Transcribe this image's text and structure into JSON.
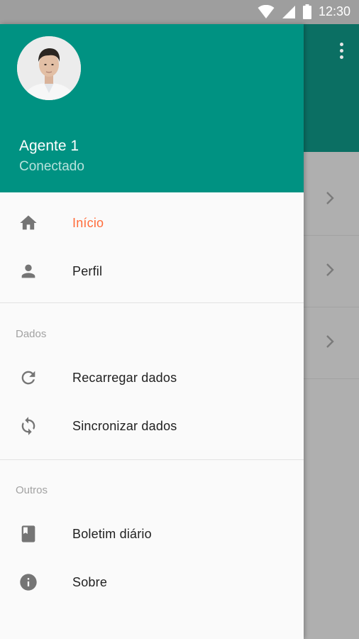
{
  "status_bar": {
    "time": "12:30",
    "icons": [
      "wifi-icon",
      "signal-icon",
      "battery-icon"
    ]
  },
  "colors": {
    "header": "#009282",
    "active": "#ff6c3a",
    "background_toolbar": "#0b6f63"
  },
  "drawer": {
    "header": {
      "name": "Agente 1",
      "status": "Conectado"
    },
    "items_main": [
      {
        "label": "Início",
        "icon": "home-icon",
        "active": true
      },
      {
        "label": "Perfil",
        "icon": "person-icon",
        "active": false
      }
    ],
    "section_dados": {
      "title": "Dados",
      "items": [
        {
          "label": "Recarregar dados",
          "icon": "refresh-icon"
        },
        {
          "label": "Sincronizar dados",
          "icon": "sync-icon"
        }
      ]
    },
    "section_outros": {
      "title": "Outros",
      "items": [
        {
          "label": "Boletim diário",
          "icon": "book-icon"
        },
        {
          "label": "Sobre",
          "icon": "info-icon"
        }
      ]
    }
  },
  "background": {
    "menu_icon": "more-vert-icon",
    "row_icon": "chevron-right-icon"
  }
}
